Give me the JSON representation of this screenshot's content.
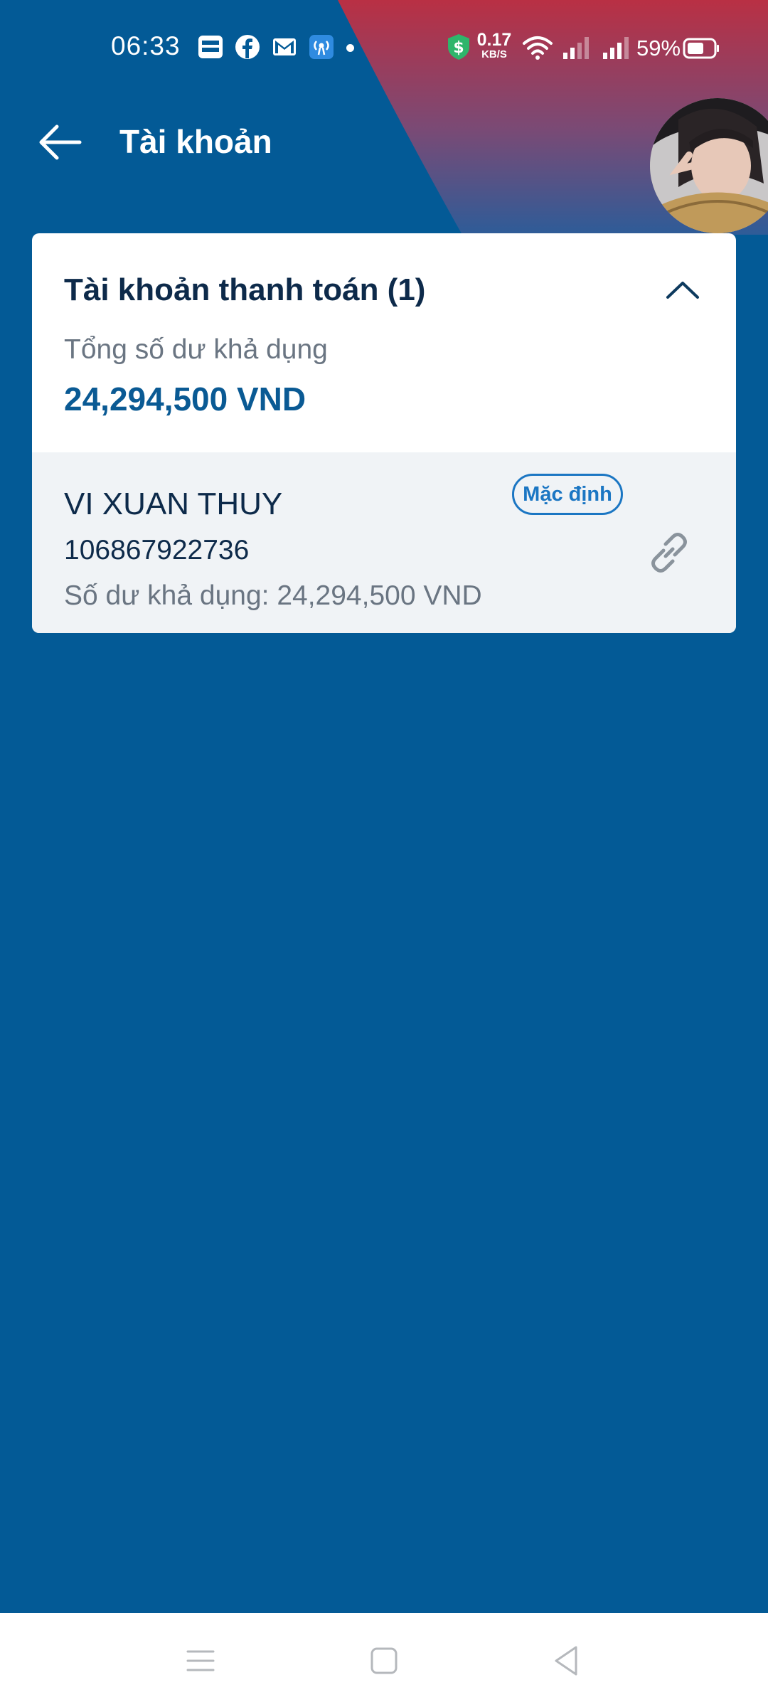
{
  "status_bar": {
    "time": "06:33",
    "net_speed_value": "0.17",
    "net_speed_unit": "KB/S",
    "battery": "59%",
    "icons": [
      "bao-moi-icon",
      "facebook-icon",
      "gmail-icon",
      "hotspot-icon",
      "shield-dollar-icon",
      "wifi-icon",
      "signal-icon",
      "battery-icon"
    ]
  },
  "header": {
    "title": "Tài khoản",
    "back_icon": "arrow-left-icon"
  },
  "accounts_section": {
    "title": "Tài khoản thanh toán (1)",
    "total_label": "Tổng số dư khả dụng",
    "total_value": "24,294,500 VND",
    "accounts": [
      {
        "name": "VI XUAN THUY",
        "number": "106867922736",
        "balance_text": "Số dư khả dụng: 24,294,500 VND",
        "badge": "Mặc định"
      }
    ]
  },
  "colors": {
    "primary_blue": "#035a96",
    "accent_red": "#b43045",
    "badge_blue": "#1b76c3"
  }
}
